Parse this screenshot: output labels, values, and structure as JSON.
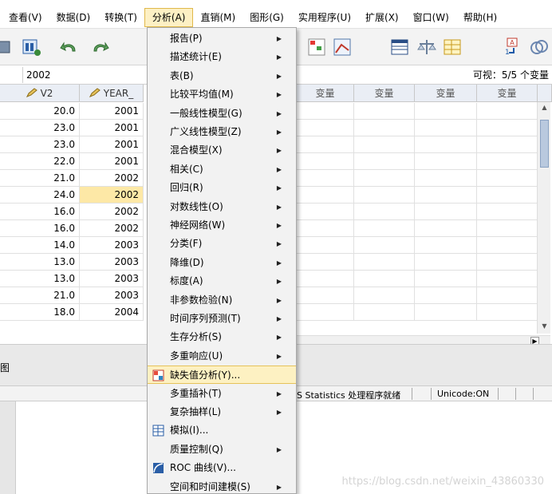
{
  "menubar": {
    "items": [
      {
        "label": "查看(V)"
      },
      {
        "label": "数据(D)"
      },
      {
        "label": "转换(T)"
      },
      {
        "label": "分析(A)"
      },
      {
        "label": "直销(M)"
      },
      {
        "label": "图形(G)"
      },
      {
        "label": "实用程序(U)"
      },
      {
        "label": "扩展(X)"
      },
      {
        "label": "窗口(W)"
      },
      {
        "label": "帮助(H)"
      }
    ]
  },
  "cell_editor": {
    "value": "2002",
    "visible_count": "可视：5/5 个变量"
  },
  "grid": {
    "columns": [
      "V2",
      "YEAR_"
    ],
    "var_header": "变量",
    "rows": [
      [
        "20.0",
        "2001"
      ],
      [
        "23.0",
        "2001"
      ],
      [
        "23.0",
        "2001"
      ],
      [
        "22.0",
        "2001"
      ],
      [
        "21.0",
        "2002"
      ],
      [
        "24.0",
        "2002"
      ],
      [
        "16.0",
        "2002"
      ],
      [
        "16.0",
        "2002"
      ],
      [
        "14.0",
        "2003"
      ],
      [
        "13.0",
        "2003"
      ],
      [
        "13.0",
        "2003"
      ],
      [
        "21.0",
        "2003"
      ],
      [
        "18.0",
        "2004"
      ]
    ],
    "selected_row": 5
  },
  "tabstrip": {
    "fragment": "图"
  },
  "statusbar": {
    "processor": "S Statistics 处理程序就绪",
    "unicode": "Unicode:ON"
  },
  "dropdown": {
    "items": [
      {
        "label": "报告(P)",
        "submenu": true
      },
      {
        "label": "描述统计(E)",
        "submenu": true
      },
      {
        "label": "表(B)",
        "submenu": true
      },
      {
        "label": "比较平均值(M)",
        "submenu": true
      },
      {
        "label": "一般线性模型(G)",
        "submenu": true
      },
      {
        "label": "广义线性模型(Z)",
        "submenu": true
      },
      {
        "label": "混合模型(X)",
        "submenu": true
      },
      {
        "label": "相关(C)",
        "submenu": true
      },
      {
        "label": "回归(R)",
        "submenu": true
      },
      {
        "label": "对数线性(O)",
        "submenu": true
      },
      {
        "label": "神经网络(W)",
        "submenu": true
      },
      {
        "label": "分类(F)",
        "submenu": true
      },
      {
        "label": "降维(D)",
        "submenu": true
      },
      {
        "label": "标度(A)",
        "submenu": true
      },
      {
        "label": "非参数检验(N)",
        "submenu": true
      },
      {
        "label": "时间序列预测(T)",
        "submenu": true
      },
      {
        "label": "生存分析(S)",
        "submenu": true
      },
      {
        "label": "多重响应(U)",
        "submenu": true
      },
      {
        "label": "缺失值分析(Y)...",
        "submenu": false,
        "highlighted": true,
        "icon": "missing-value-icon"
      },
      {
        "label": "多重插补(T)",
        "submenu": true
      },
      {
        "label": "复杂抽样(L)",
        "submenu": true
      },
      {
        "label": "模拟(I)...",
        "submenu": false,
        "icon": "simulation-icon"
      },
      {
        "label": "质量控制(Q)",
        "submenu": true
      },
      {
        "label": "ROC 曲线(V)...",
        "submenu": false,
        "icon": "roc-curve-icon"
      },
      {
        "label": "空间和时间建模(S)",
        "submenu": true
      }
    ]
  },
  "watermark": "https://blog.csdn.net/weixin_43860330",
  "colors": {
    "highlight": "#fdf1c2",
    "selected_cell": "#fde8a6",
    "header_bg": "#eaeef5"
  }
}
